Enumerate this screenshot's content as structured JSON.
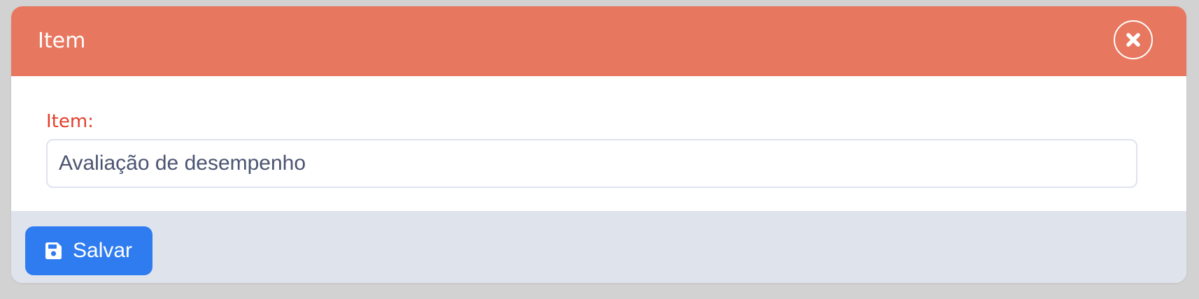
{
  "modal": {
    "title": "Item",
    "close_icon": "close-icon",
    "header_color": "#e8775f"
  },
  "form": {
    "item_label": "Item:",
    "item_value": "Avaliação de desempenho",
    "label_color": "#e3402c"
  },
  "footer": {
    "save_label": "Salvar",
    "save_icon": "floppy-disk-icon",
    "save_color": "#2f7cf0"
  }
}
